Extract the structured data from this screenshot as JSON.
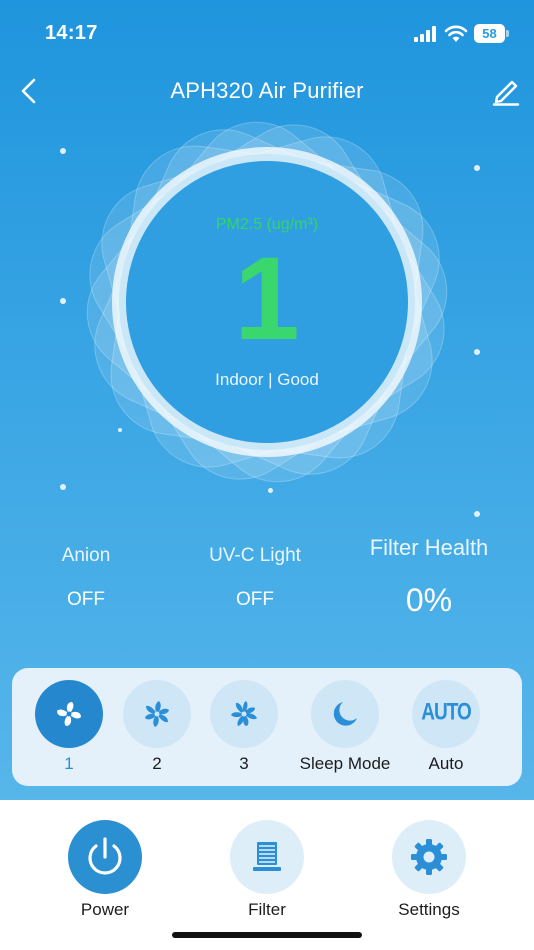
{
  "status_bar": {
    "time": "14:17",
    "battery": "58",
    "icons": [
      "signal-icon",
      "wifi-icon",
      "battery-icon"
    ]
  },
  "header": {
    "title": "APH320 Air Purifier",
    "back_icon": "chevron-left-icon",
    "edit_icon": "pencil-icon"
  },
  "gauge": {
    "label": "PM2.5 (ug/m³)",
    "value": "1",
    "status": "Indoor | Good",
    "value_color": "#3ad66e"
  },
  "stats": {
    "anion": {
      "label": "Anion",
      "value": "OFF"
    },
    "uvc": {
      "label": "UV-C Light",
      "value": "OFF"
    },
    "filter_health": {
      "label": "Filter Health",
      "value": "0%"
    }
  },
  "modes": [
    {
      "label": "1",
      "icon": "fan-speed-1-icon",
      "active": true
    },
    {
      "label": "2",
      "icon": "fan-speed-2-icon",
      "active": false
    },
    {
      "label": "3",
      "icon": "fan-speed-3-icon",
      "active": false
    },
    {
      "label": "Sleep Mode",
      "icon": "moon-icon",
      "active": false
    },
    {
      "label": "Auto",
      "icon": "auto-icon",
      "icon_text": "AUTO",
      "active": false
    }
  ],
  "nav": {
    "power": {
      "label": "Power",
      "icon": "power-icon"
    },
    "filter": {
      "label": "Filter",
      "icon": "filter-icon"
    },
    "settings": {
      "label": "Settings",
      "icon": "gear-icon"
    }
  },
  "colors": {
    "accent": "#2a90d2",
    "background_top": "#1f95dd",
    "background_bottom": "#57b6ea",
    "good": "#3ad66e"
  }
}
